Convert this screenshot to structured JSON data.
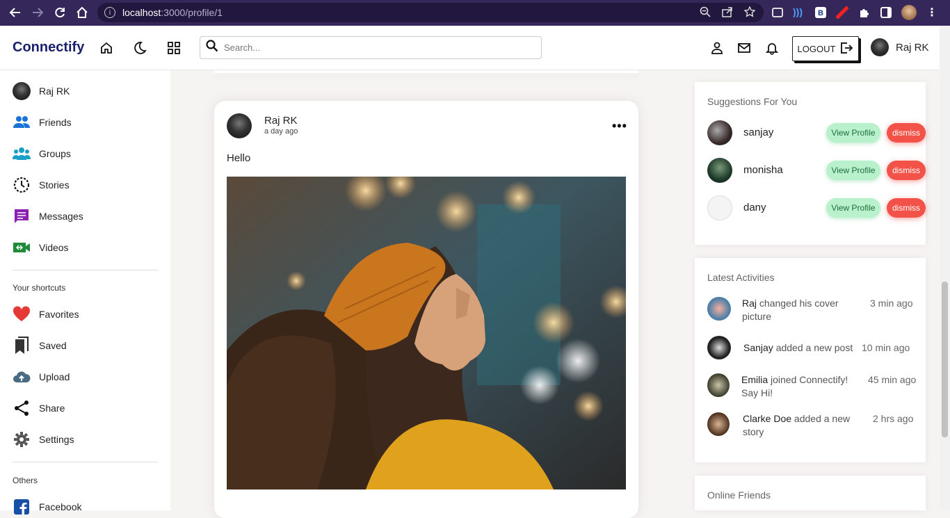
{
  "browser": {
    "url_host": "localhost",
    "url_path": ":3000/profile/1"
  },
  "app": {
    "logo": "Connectify",
    "search_placeholder": "Search...",
    "logout_label": "LOGOUT",
    "current_user": "Raj RK"
  },
  "sidebar": {
    "user": "Raj RK",
    "items": [
      {
        "label": "Friends",
        "icon": "friends-icon"
      },
      {
        "label": "Groups",
        "icon": "groups-icon"
      },
      {
        "label": "Stories",
        "icon": "stories-icon"
      },
      {
        "label": "Messages",
        "icon": "messages-icon"
      },
      {
        "label": "Videos",
        "icon": "videos-icon"
      }
    ],
    "shortcuts_heading": "Your shortcuts",
    "shortcuts": [
      {
        "label": "Favorites",
        "icon": "heart-icon"
      },
      {
        "label": "Saved",
        "icon": "bookmark-icon"
      },
      {
        "label": "Upload",
        "icon": "cloud-upload-icon"
      },
      {
        "label": "Share",
        "icon": "share-icon"
      },
      {
        "label": "Settings",
        "icon": "gear-icon"
      }
    ],
    "others_heading": "Others",
    "others": [
      {
        "label": "Facebook",
        "icon": "facebook-icon"
      }
    ]
  },
  "post": {
    "author": "Raj RK",
    "time": "a day ago",
    "text": "Hello"
  },
  "suggestions": {
    "title": "Suggestions For You",
    "view_label": "View Profile",
    "dismiss_label": "dismiss",
    "people": [
      "sanjay",
      "monisha",
      "dany"
    ]
  },
  "activities": {
    "title": "Latest Activities",
    "items": [
      {
        "user": "Raj",
        "action": "changed his cover picture",
        "time": "3 min ago"
      },
      {
        "user": "Sanjay",
        "action": "added a new post",
        "time": "10 min ago"
      },
      {
        "user": "Emilia",
        "action": "joined Connectify! Say Hi!",
        "time": "45 min ago"
      },
      {
        "user": "Clarke Doe",
        "action": "added a new story",
        "time": "2 hrs ago"
      }
    ]
  },
  "online": {
    "title": "Online Friends"
  },
  "colors": {
    "brand": "#1a1f6e",
    "dismiss": "#f25248",
    "view_profile": "#b8f1cc",
    "browser_frame": "#35275a"
  }
}
